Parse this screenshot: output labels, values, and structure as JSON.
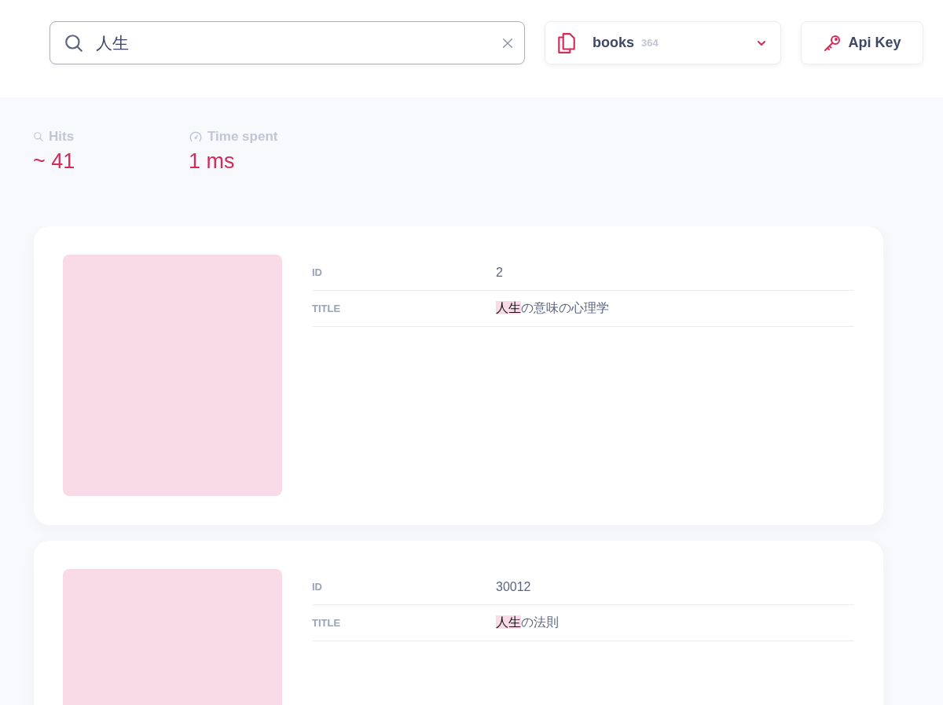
{
  "search": {
    "value": "人生"
  },
  "index_select": {
    "name": "books",
    "count": "364"
  },
  "api_key_button": {
    "label": "Api Key"
  },
  "stats": [
    {
      "kind": "hits",
      "label": "Hits",
      "value": "~ 41"
    },
    {
      "kind": "time",
      "label": "Time spent",
      "value": "1 ms"
    }
  ],
  "results": [
    {
      "fields": [
        {
          "label": "ID",
          "value": {
            "rest": "2"
          }
        },
        {
          "label": "TITLE",
          "value": {
            "match": "人生",
            "rest": "の意味の心理学"
          }
        }
      ]
    },
    {
      "fields": [
        {
          "label": "ID",
          "value": {
            "rest": "30012"
          }
        },
        {
          "label": "TITLE",
          "value": {
            "match": "人生",
            "rest": "の法則"
          }
        }
      ]
    }
  ]
}
